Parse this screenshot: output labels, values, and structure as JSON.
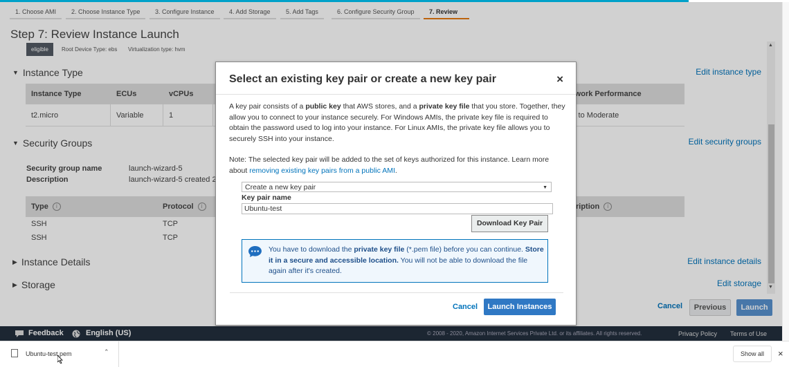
{
  "wizard_steps": [
    {
      "label": "1. Choose AMI"
    },
    {
      "label": "2. Choose Instance Type"
    },
    {
      "label": "3. Configure Instance"
    },
    {
      "label": "4. Add Storage"
    },
    {
      "label": "5. Add Tags"
    },
    {
      "label": "6. Configure Security Group"
    },
    {
      "label": "7. Review"
    }
  ],
  "page": {
    "title": "Step 7: Review Instance Launch",
    "eligible_badge": "eligible",
    "root_device": "Root Device Type: ebs",
    "virtualization": "Virtualization type: hvm"
  },
  "instance_type": {
    "heading": "Instance Type",
    "edit_link": "Edit instance type",
    "columns": [
      "Instance Type",
      "ECUs",
      "vCPUs",
      "twork Performance"
    ],
    "row": [
      "t2.micro",
      "Variable",
      "1",
      "v to Moderate"
    ]
  },
  "security_groups": {
    "heading": "Security Groups",
    "edit_link": "Edit security groups",
    "name_label": "Security group name",
    "name_value": "launch-wizard-5",
    "desc_label": "Description",
    "desc_value": "launch-wizard-5 created 20",
    "columns": [
      "Type",
      "Protocol",
      "ription"
    ],
    "rows": [
      [
        "SSH",
        "TCP"
      ],
      [
        "SSH",
        "TCP"
      ]
    ]
  },
  "instance_details": {
    "heading": "Instance Details",
    "edit_link": "Edit instance details"
  },
  "storage": {
    "heading": "Storage",
    "edit_link": "Edit storage"
  },
  "bottom_buttons": {
    "cancel": "Cancel",
    "previous": "Previous",
    "launch": "Launch"
  },
  "footer": {
    "feedback": "Feedback",
    "language": "English (US)",
    "copyright": "© 2008 - 2020, Amazon Internet Services Private Ltd. or its affiliates. All rights reserved.",
    "privacy": "Privacy Policy",
    "terms": "Terms of Use"
  },
  "modal": {
    "title": "Select an existing key pair or create a new key pair",
    "close": "×",
    "para1_parts": {
      "a": "A key pair consists of a ",
      "b": "public key",
      "c": " that AWS stores, and a ",
      "d": "private key file",
      "e": " that you store. Together, they allow you to connect to your instance securely. For Windows AMIs, the private key file is required to obtain the password used to log into your instance. For Linux AMIs, the private key file allows you to securely SSH into your instance."
    },
    "note_text": "Note: The selected key pair will be added to the set of keys authorized for this instance. Learn more about ",
    "note_link": "removing existing key pairs from a public AMI",
    "note_end": ".",
    "select_value": "Create a new key pair",
    "keypair_label": "Key pair name",
    "keypair_value": "Ubuntu-test",
    "download_button": "Download Key Pair",
    "info_parts": {
      "a": "You have to download the ",
      "b": "private key file",
      "c": " (*.pem file) before you can continue. ",
      "d": "Store it in a secure and accessible location.",
      "e": " You will not be able to download the file again after it's created."
    },
    "cancel": "Cancel",
    "launch": "Launch Instances"
  },
  "downloads_bar": {
    "file_name": "Ubuntu-test.pem",
    "show_all": "Show all",
    "close": "×"
  },
  "colors": {
    "accent_blue": "#0073bb",
    "primary_button": "#2f78c4",
    "footer_bg": "#232f3e",
    "active_step": "#e47911"
  }
}
